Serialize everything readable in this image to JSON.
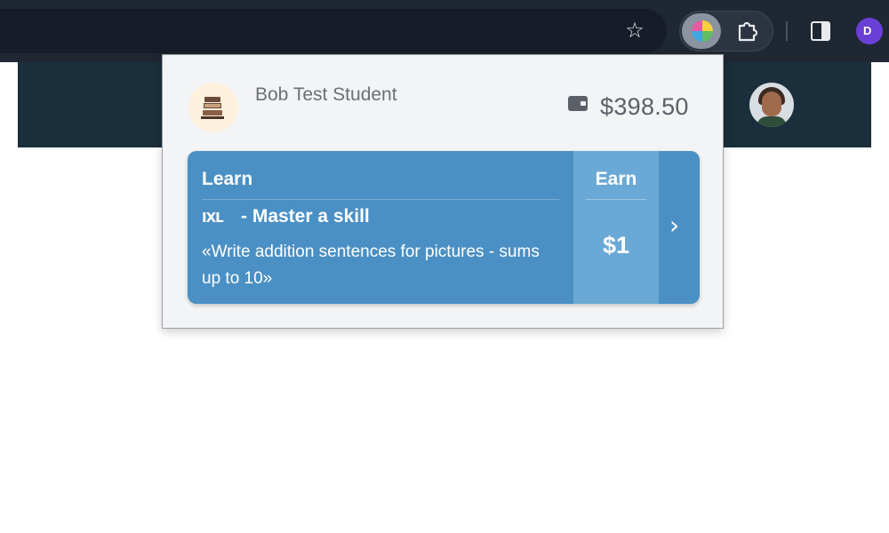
{
  "browser": {
    "toolbar_icons": [
      "star-icon",
      "ixl-rewards-extension-icon",
      "puzzle-icon",
      "side-panel-icon"
    ],
    "profile_initial": "D"
  },
  "popup": {
    "student_name": "Bob Test Student",
    "balance": "$398.50",
    "card": {
      "learn_label": "Learn",
      "earn_label": "Earn",
      "provider_logo": "IXL",
      "skill_title": "- Master a skill",
      "skill_description": "«Write addition sentences for pictures - sums up to 10»",
      "reward": "$1"
    }
  },
  "colors": {
    "card_blue": "#4a90c4",
    "earn_blue": "#6aa9d5",
    "header_navy": "#1b2e3c"
  }
}
